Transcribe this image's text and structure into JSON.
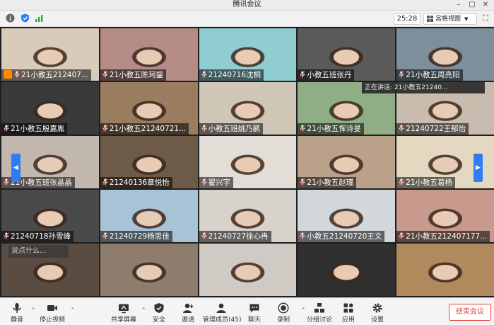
{
  "window": {
    "title": "腾讯会议",
    "controls": [
      "–",
      "□",
      "✕"
    ]
  },
  "top_toolbar": {
    "timer": "25:28",
    "view_mode": "宫格视图"
  },
  "speaking_indicator": "正在讲话: 21小教五21240...",
  "chat_bubble": "说点什么...",
  "participants": [
    {
      "name": "21小教五212407...",
      "bg": "#d9cbb9",
      "host": true
    },
    {
      "name": "21小教五陈珂鋆",
      "bg": "#b58b86",
      "host": false
    },
    {
      "name": "21240716沈桐",
      "bg": "#8fcdd0",
      "host": false
    },
    {
      "name": "小教五班张丹",
      "bg": "#5a5a5a",
      "host": false
    },
    {
      "name": "21小教五周亮阳",
      "bg": "#7c8f9a",
      "host": false
    },
    {
      "name": "21小教五殷嘉胤",
      "bg": "#3a3a3a",
      "host": false
    },
    {
      "name": "21小教五21240721...",
      "bg": "#9a7d5e",
      "host": false
    },
    {
      "name": "小教五班姚乃鹂",
      "bg": "#cfc6b6",
      "host": false
    },
    {
      "name": "21小教五恽诗旻",
      "bg": "#8fae86",
      "host": false
    },
    {
      "name": "21240722王郁怡",
      "bg": "#c9bcaf",
      "host": false
    },
    {
      "name": "21小教五班张晶晶",
      "bg": "#c2b7ad",
      "host": false
    },
    {
      "name": "21240136章悦怡",
      "bg": "#6d5a47",
      "host": false
    },
    {
      "name": "翟兴宇",
      "bg": "#e2ddd6",
      "host": false
    },
    {
      "name": "21小教五赵瑾",
      "bg": "#b9a18a",
      "host": false
    },
    {
      "name": "21小教五葛杨",
      "bg": "#e5d8c0",
      "host": false
    },
    {
      "name": "21240718孙雪峰",
      "bg": "#4a4a4a",
      "host": false
    },
    {
      "name": "21240729杨思佳",
      "bg": "#a9c3d6",
      "host": false
    },
    {
      "name": "21240727徐心冉",
      "bg": "#d7d2cc",
      "host": false
    },
    {
      "name": "小教五21240720王文",
      "bg": "#d2d7dc",
      "host": false
    },
    {
      "name": "21小教五212407177...",
      "bg": "#c89a8d",
      "host": false
    },
    {
      "name": "",
      "bg": "#5a4c40",
      "host": false
    },
    {
      "name": "",
      "bg": "#8e7c6d",
      "host": false
    },
    {
      "name": "",
      "bg": "#cfcac4",
      "host": false
    },
    {
      "name": "",
      "bg": "#2f2f2f",
      "host": false
    },
    {
      "name": "",
      "bg": "#b08a5c",
      "host": false
    }
  ],
  "bottom_toolbar": {
    "buttons": [
      {
        "key": "mute",
        "label": "静音",
        "icon": "microphone-icon"
      },
      {
        "key": "stopvideo",
        "label": "停止视频",
        "icon": "video-camera-icon"
      },
      {
        "key": "share",
        "label": "共享屏幕",
        "icon": "share-screen-icon"
      },
      {
        "key": "security",
        "label": "安全",
        "icon": "shield-icon"
      },
      {
        "key": "invite",
        "label": "邀请",
        "icon": "add-user-icon"
      },
      {
        "key": "members",
        "label": "管理成员(45)",
        "icon": "members-icon"
      },
      {
        "key": "chat",
        "label": "聊天",
        "icon": "chat-icon"
      },
      {
        "key": "record",
        "label": "录制",
        "icon": "record-icon"
      },
      {
        "key": "breakout",
        "label": "分组讨论",
        "icon": "breakout-icon"
      },
      {
        "key": "apps",
        "label": "应用",
        "icon": "apps-icon"
      },
      {
        "key": "settings",
        "label": "设置",
        "icon": "gear-icon"
      }
    ],
    "end_meeting": "结束会议"
  },
  "colors": {
    "accent_blue": "#2e7cf6",
    "end_red": "#e0443b",
    "host_orange": "#ff8a00"
  }
}
